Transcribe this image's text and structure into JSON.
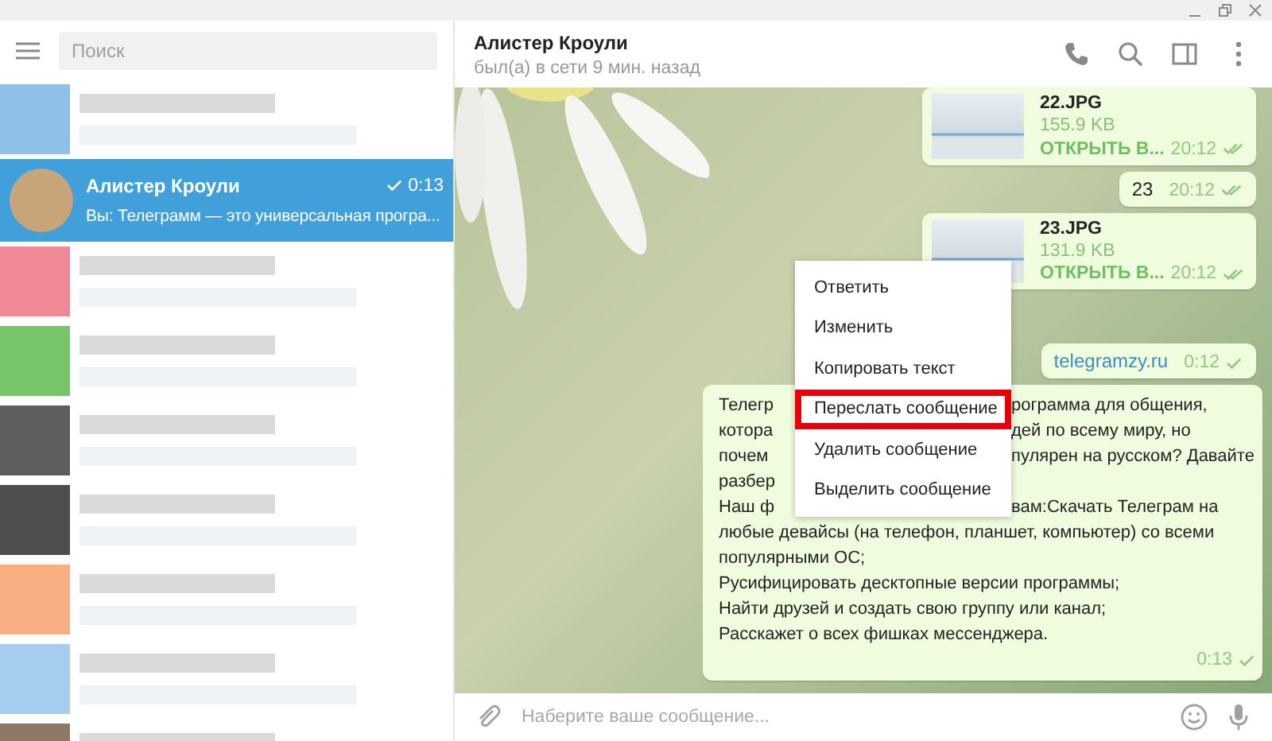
{
  "sidebar": {
    "search": {
      "placeholder": "Поиск"
    },
    "chats_before": [
      {
        "color": "#8fc0e8"
      }
    ],
    "selected_chat": {
      "name": "Алистер Кроули",
      "time": "0:13",
      "preview": "Вы: Телеграмм — это универсальная програ...",
      "selected": true,
      "sent": true
    },
    "chats_after": [
      {
        "color": "#f08898"
      },
      {
        "color": "#78c46a"
      },
      {
        "color": "#5e5e5e"
      },
      {
        "color": "#4e4e4e"
      },
      {
        "color": "#f7ae80"
      },
      {
        "color": "#a4cdf0"
      },
      {
        "color": "#8a7a66"
      }
    ]
  },
  "chat": {
    "title": "Алистер Кроули",
    "status": "был(а) в сети 9 мин. назад",
    "messages": [
      {
        "kind": "file",
        "name": "22.JPG",
        "size": "155.9 KB",
        "action": "ОТКРЫТЬ В...",
        "time": "20:12",
        "read": true
      },
      {
        "kind": "text",
        "text": "23",
        "time": "20:12",
        "read": true
      },
      {
        "kind": "file",
        "name": "23.JPG",
        "size": "131.9 KB",
        "action": "ОТКРЫТЬ В...",
        "time": "20:12",
        "read": true
      },
      {
        "kind": "link",
        "text": "telegramzy.ru",
        "time": "0:12",
        "read": false
      },
      {
        "kind": "long",
        "time": "0:13",
        "read": false,
        "covered_lines": [
          {
            "left": "Телегр",
            "right": "рограмма для общения,"
          },
          {
            "left": "котора",
            "right": "дей по всему миру, но"
          },
          {
            "left": "почем",
            "right": "пулярен на русском? Давайте"
          },
          {
            "left": "разбер"
          },
          {
            "left": "Наш ф",
            "right": "вам:Скачать Телеграм на"
          }
        ],
        "lines": [
          "любые девайсы (на телефон, планшет, компьютер) со всеми",
          "популярными ОС;",
          "Русифицировать десктопные версии программы;",
          "Найти друзей и создать свою группу или канал;",
          "Расскажет о всех фишках мессенджера."
        ]
      }
    ],
    "context_menu": [
      {
        "label": "Ответить",
        "highlighted": false
      },
      {
        "label": "Изменить",
        "highlighted": false
      },
      {
        "label": "Копировать текст",
        "highlighted": false
      },
      {
        "label": "Переслать сообщение",
        "highlighted": true
      },
      {
        "label": "Удалить сообщение",
        "highlighted": false
      },
      {
        "label": "Выделить сообщение",
        "highlighted": false
      }
    ],
    "composer": {
      "placeholder": "Наберите ваше сообщение..."
    }
  }
}
